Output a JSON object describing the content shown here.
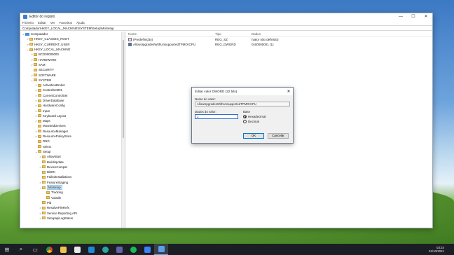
{
  "window": {
    "title": "Editor do registo",
    "controls": {
      "minimize": "—",
      "maximize": "☐",
      "close": "✕"
    }
  },
  "menu": [
    "Ficheiro",
    "Editar",
    "Ver",
    "Favoritos",
    "Ajuda"
  ],
  "address": "Computador\\HKEY_LOCAL_MACHINE\\SYSTEM\\Setup\\MoSetup",
  "tree": [
    {
      "depth": 0,
      "exp": "⌄",
      "icon": "computer",
      "label": "Computador"
    },
    {
      "depth": 1,
      "exp": ">",
      "icon": "folder",
      "label": "HKEY_CLASSES_ROOT"
    },
    {
      "depth": 1,
      "exp": ">",
      "icon": "folder",
      "label": "HKEY_CURRENT_USER"
    },
    {
      "depth": 1,
      "exp": "⌄",
      "icon": "folder",
      "label": "HKEY_LOCAL_MACHINE"
    },
    {
      "depth": 2,
      "exp": ">",
      "icon": "folder",
      "label": "BCD00000000"
    },
    {
      "depth": 2,
      "exp": ">",
      "icon": "folder",
      "label": "HARDWARE"
    },
    {
      "depth": 2,
      "exp": ">",
      "icon": "folder",
      "label": "SAM"
    },
    {
      "depth": 2,
      "exp": "",
      "icon": "folder",
      "label": "SECURITY"
    },
    {
      "depth": 2,
      "exp": ">",
      "icon": "folder",
      "label": "SOFTWARE"
    },
    {
      "depth": 2,
      "exp": "⌄",
      "icon": "folder",
      "label": "SYSTEM"
    },
    {
      "depth": 3,
      "exp": ">",
      "icon": "folder",
      "label": "ActivationBroker"
    },
    {
      "depth": 3,
      "exp": ">",
      "icon": "folder",
      "label": "ControlSet001"
    },
    {
      "depth": 3,
      "exp": ">",
      "icon": "folder",
      "label": "CurrentControlSet"
    },
    {
      "depth": 3,
      "exp": ">",
      "icon": "folder",
      "label": "DriverDatabase"
    },
    {
      "depth": 3,
      "exp": ">",
      "icon": "folder",
      "label": "HardwareConfig"
    },
    {
      "depth": 3,
      "exp": ">",
      "icon": "folder",
      "label": "Input"
    },
    {
      "depth": 3,
      "exp": ">",
      "icon": "folder",
      "label": "Keyboard Layout"
    },
    {
      "depth": 3,
      "exp": ">",
      "icon": "folder",
      "label": "Maps"
    },
    {
      "depth": 3,
      "exp": "",
      "icon": "folder",
      "label": "MountedDevices"
    },
    {
      "depth": 3,
      "exp": ">",
      "icon": "folder",
      "label": "ResourceManager"
    },
    {
      "depth": 3,
      "exp": ">",
      "icon": "folder",
      "label": "ResourcePolicyStore"
    },
    {
      "depth": 3,
      "exp": "",
      "icon": "folder",
      "label": "RNG"
    },
    {
      "depth": 3,
      "exp": "",
      "icon": "folder",
      "label": "Select"
    },
    {
      "depth": 3,
      "exp": "⌄",
      "icon": "folder",
      "label": "Setup"
    },
    {
      "depth": 4,
      "exp": ">",
      "icon": "folder",
      "label": "AllowStart"
    },
    {
      "depth": 4,
      "exp": "",
      "icon": "folder",
      "label": "BuildUpdate"
    },
    {
      "depth": 4,
      "exp": ">",
      "icon": "folder",
      "label": "DeviceCompat"
    },
    {
      "depth": 4,
      "exp": "",
      "icon": "folder",
      "label": "DiDRI"
    },
    {
      "depth": 4,
      "exp": "",
      "icon": "folder",
      "label": "FailedInstallations"
    },
    {
      "depth": 4,
      "exp": ">",
      "icon": "folder",
      "label": "FeatureStaging"
    },
    {
      "depth": 4,
      "exp": "⌄",
      "icon": "folder",
      "label": "MoSetup",
      "selected": true
    },
    {
      "depth": 5,
      "exp": "",
      "icon": "folder",
      "label": "Tracking"
    },
    {
      "depth": 5,
      "exp": "",
      "icon": "folder",
      "label": "Volatile"
    },
    {
      "depth": 4,
      "exp": "",
      "icon": "folder",
      "label": "Pid"
    },
    {
      "depth": 4,
      "exp": ">",
      "icon": "folder",
      "label": "ResolveFileRefs"
    },
    {
      "depth": 4,
      "exp": ">",
      "icon": "folder",
      "label": "Service Reporting API"
    },
    {
      "depth": 4,
      "exp": ">",
      "icon": "folder",
      "label": "SetupapiLogStatus"
    }
  ],
  "values": {
    "headers": {
      "name": "Nome",
      "type": "Tipo",
      "data": "Dados"
    },
    "rows": [
      {
        "icon": "string",
        "name": "(Predefinição)",
        "type": "REG_SZ",
        "data": "(valor não definido)"
      },
      {
        "icon": "dword",
        "name": "AllowUpgradesWithUnsupportedTPMOrCPU",
        "type": "REG_DWORD",
        "data": "0x00000001 (1)"
      }
    ]
  },
  "dialog": {
    "title": "Editar valor DWORD (32 bits)",
    "name_label": "Nome do valor:",
    "name_value": "AllowUpgradesWithUnsupportedTPMOrCPU",
    "data_label": "Dados do valor:",
    "data_value": "1",
    "base_label": "Base",
    "radio_hex": "Hexadecimal",
    "radio_dec": "Decimal",
    "base_selected": "hex",
    "ok": "OK",
    "cancel": "Cancelar"
  },
  "taskbar": {
    "icons": [
      "windows-start",
      "search",
      "task-view",
      "chrome",
      "folder",
      "mail",
      "vscode",
      "edge",
      "teams",
      "spotify",
      "store",
      "regedit"
    ],
    "time": "03:24",
    "date": "01/10/2021"
  }
}
